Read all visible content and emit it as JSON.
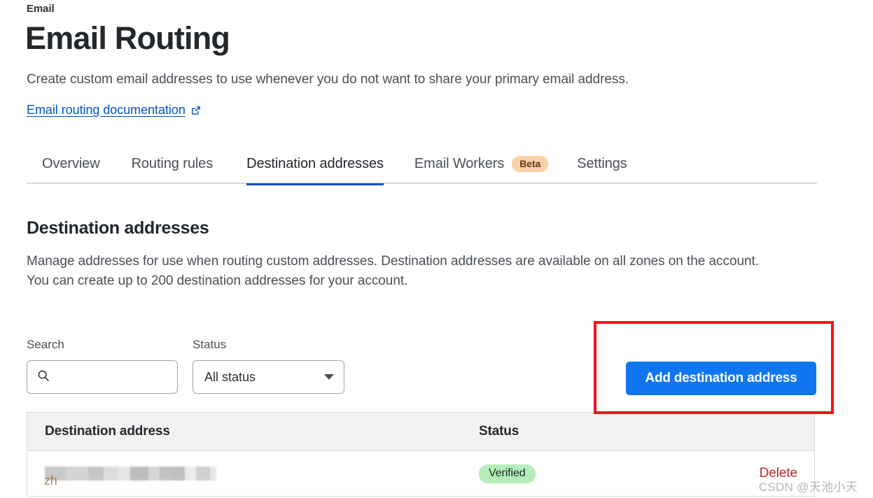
{
  "header": {
    "breadcrumb": "Email",
    "title": "Email Routing",
    "description": "Create custom email addresses to use whenever you do not want to share your primary email address.",
    "doc_link_label": "Email routing documentation",
    "doc_link_icon": "external-link-icon"
  },
  "tabs": [
    {
      "label": "Overview",
      "active": false
    },
    {
      "label": "Routing rules",
      "active": false
    },
    {
      "label": "Destination addresses",
      "active": true
    },
    {
      "label": "Email Workers",
      "active": false,
      "badge": "Beta"
    },
    {
      "label": "Settings",
      "active": false
    }
  ],
  "section": {
    "title": "Destination addresses",
    "description_line1": "Manage addresses for use when routing custom addresses. Destination addresses are available on all zones on the account.",
    "description_line2": "You can create up to 200 destination addresses for your account."
  },
  "controls": {
    "search_label": "Search",
    "search_value": "",
    "search_placeholder": "",
    "search_icon": "search-icon",
    "status_label": "Status",
    "status_value": "All status",
    "status_options": [
      "All status"
    ],
    "add_button_label": "Add destination address"
  },
  "table": {
    "columns": [
      "Destination address",
      "Status"
    ],
    "rows": [
      {
        "address": "",
        "address_redacted": true,
        "address_visible_prefix": "zh",
        "status": "Verified",
        "action": "Delete"
      }
    ]
  },
  "watermark": "CSDN @天池小天",
  "colors": {
    "accent_blue": "#1076ef",
    "tab_active_underline": "#1452c8",
    "link_blue": "#0051c3",
    "annotation_red": "#fc0d1b",
    "badge_beta_bg": "#fbd1a7",
    "badge_verified_bg": "#b6ecb9",
    "delete_red": "#bd2527"
  }
}
